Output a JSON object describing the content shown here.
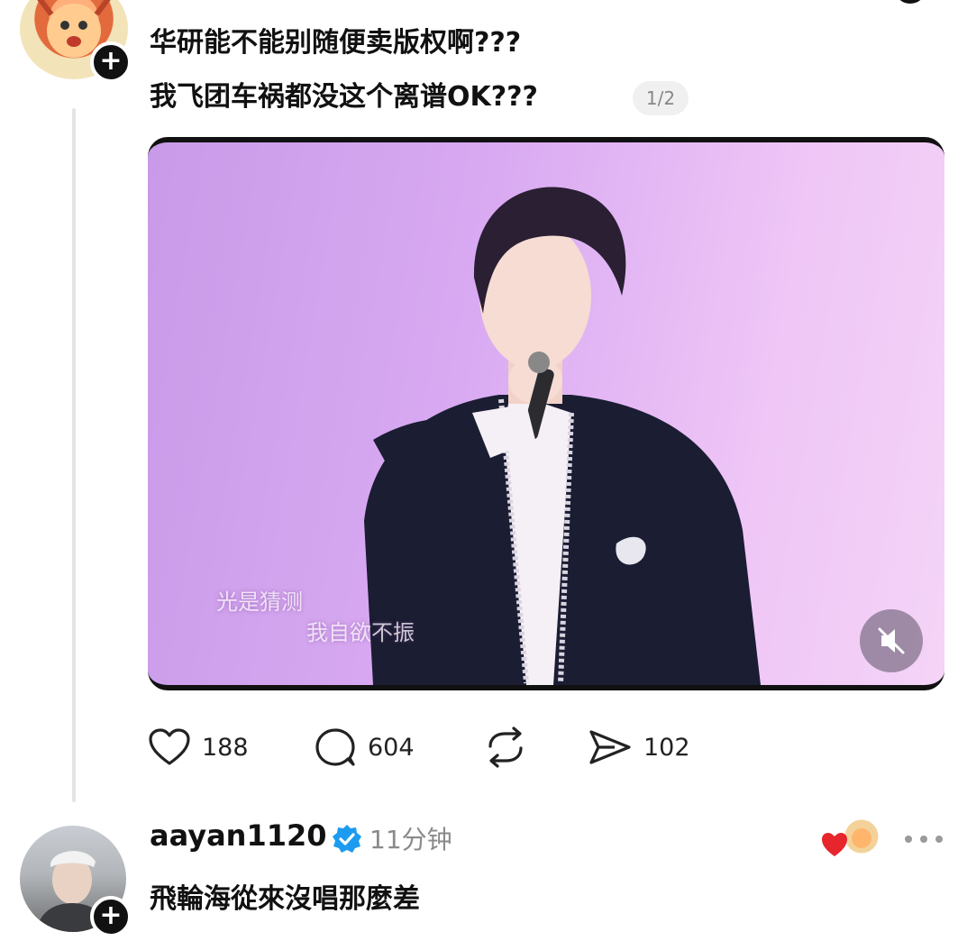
{
  "post": {
    "text_line1": "华研能不能别随便卖版权啊???",
    "text_line2": "我飞团车祸都没这个离谱OK???",
    "media_counter": "1/2",
    "media": {
      "lyric_line1": "光是猜测",
      "lyric_line2": "我自欲不振",
      "mute_icon": "speaker-muted-icon"
    },
    "actions": {
      "likes": "188",
      "comments": "604",
      "shares": "102"
    }
  },
  "reply": {
    "username": "aayan1120",
    "verified": true,
    "time": "11分钟",
    "text": "飛輪海從來沒唱那麼差"
  },
  "colors": {
    "verified_blue": "#1d9bf0",
    "heart_red": "#e6252c",
    "muted_gray": "#8a8a8a"
  }
}
